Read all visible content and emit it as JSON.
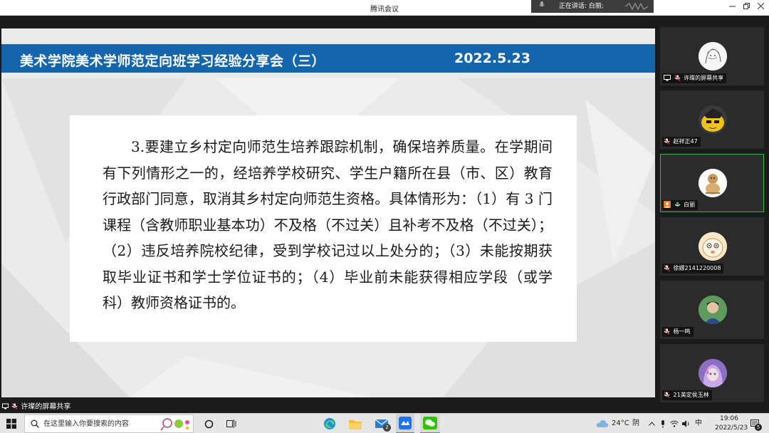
{
  "window": {
    "title": "腾讯会议",
    "speaking_label": "正在讲话: 白丽;"
  },
  "slide": {
    "title": "美术学院美术学师范定向班学习经验分享会（三）",
    "date": "2022.5.23",
    "paragraph": "3.要建立乡村定向师范生培养跟踪机制，确保培养质量。在学期间有下列情形之一的，经培养学校研究、学生户籍所在县（市、区）教育行政部门同意，取消其乡村定向师范生资格。具体情形为：（1）有 3 门课程（含教师职业基本功）不及格（不过关）且补考不及格（不过关）；（2）违反培养院校纪律，受到学校记过以上处分的；（3）未能按期获取毕业证书和学士学位证书的；（4）毕业前未能获得相应学段（或学科）教师资格证书的。"
  },
  "share_bar": {
    "label": "许璨的屏幕共享"
  },
  "participants": [
    {
      "name": "许璨的屏幕共享",
      "muted": true,
      "screen_share": true,
      "active": false
    },
    {
      "name": "赵祥正47",
      "muted": true,
      "screen_share": false,
      "active": false
    },
    {
      "name": "白丽",
      "muted": false,
      "screen_share": false,
      "active": true
    },
    {
      "name": "徐娜2141220008",
      "muted": true,
      "screen_share": false,
      "active": false
    },
    {
      "name": "杨一鸣",
      "muted": true,
      "screen_share": false,
      "active": false
    },
    {
      "name": "21美定侯玉林",
      "muted": true,
      "screen_share": false,
      "active": false
    }
  ],
  "taskbar": {
    "search_placeholder": "在这里输入你要搜索的内容",
    "mail_badge": "2",
    "weather_temp": "24°C",
    "weather_desc": "阴",
    "ime": "中",
    "time": "19:06",
    "date": "2022/5/23",
    "notification_count": "5"
  },
  "colors": {
    "slide_header": "#1565ad",
    "active_speaker_border": "#35b84a",
    "panel_bg": "#1b1b1b"
  }
}
